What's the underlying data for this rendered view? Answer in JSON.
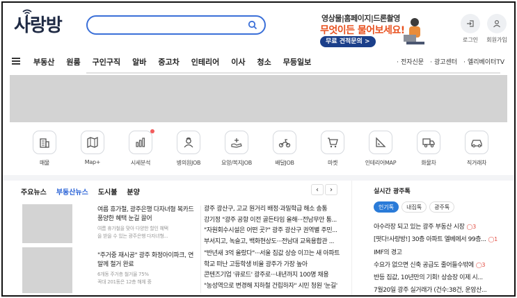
{
  "header": {
    "logo": "사랑방",
    "search": {
      "value": "",
      "placeholder": ""
    },
    "ad": {
      "line1": "영상물|홈페이지|드론촬영",
      "line2": "무엇이든 물어보세요!",
      "button": "무료 견적문의 >"
    },
    "login_label": "로그인",
    "signup_label": "회원가입"
  },
  "nav": {
    "items": [
      "부동산",
      "원룸",
      "구인구직",
      "알바",
      "중고차",
      "인테리어",
      "이사",
      "청소",
      "무등일보"
    ],
    "right": [
      "전자신문",
      "광고센터",
      "엘리베이터TV"
    ]
  },
  "quick_menu": [
    {
      "label": "매물",
      "icon": "building-icon"
    },
    {
      "label": "Map+",
      "icon": "map-icon"
    },
    {
      "label": "시세분석",
      "icon": "chart-icon",
      "badge": true
    },
    {
      "label": "병의원JOB",
      "icon": "nurse-icon"
    },
    {
      "label": "요양/복지JOB",
      "icon": "care-icon"
    },
    {
      "label": "배달JOB",
      "icon": "scooter-icon"
    },
    {
      "label": "마켓",
      "icon": "cart-icon"
    },
    {
      "label": "인테리어MAP",
      "icon": "ruler-icon"
    },
    {
      "label": "화물차",
      "icon": "truck-icon"
    },
    {
      "label": "직거래차",
      "icon": "car-icon"
    }
  ],
  "news": {
    "tabs": [
      "주요뉴스",
      "부동산뉴스",
      "도시불",
      "분양"
    ],
    "active_tab": 1,
    "featured": [
      {
        "title": "여름 휴가철, 광주은행 다자녀형 복카드 풍양한 혜택 눈길 끌어",
        "desc1": "여름 휴가철을 맞아 다양한 할인 혜택",
        "desc2": "을 받을 수 있는 광주은행 다자녀형..."
      },
      {
        "title": "\"주거중 재시공\" 광주 화정아이파크, 연말께 철거 완료",
        "desc1": "6개동 주거층 철거율 75%",
        "desc2": "꼭대 201동은 12층 해체 중"
      }
    ],
    "headlines_top": [
      "광주 광산구, 고교 원거리 배정·과밀학급 해소 송통",
      "강기정 \"광주 공항 이전 골든타임 올해···전남무안 통...",
      "\"자원회수시설은 어떤 곳?\" 광주 광산구 권역별 주민...",
      "부서지고, 녹슬고, 백화현상도···전남대 교육용합관 ..."
    ],
    "headlines_bottom": [
      "\"반년새 3억 올랐다\"···서울 집값 상승 이끄는 새 아파트",
      "학교 떠난 고등학생 비율 광주가 가장 높아",
      "콘텐즈기업 '큐로드' 광주로···내년까지 100명 채용",
      "\"농성역으로 변경해 지하철 건립하자\" 시민 청원 '눈길'"
    ]
  },
  "realtime": {
    "title": "실시간 광주톡",
    "tabs": [
      "인기톡",
      "내집톡",
      "광주톡"
    ],
    "active_tab": 0,
    "items": [
      {
        "text": "아수라장 되고 있는 광주 부동산 시장",
        "count": "3"
      },
      {
        "text": "[떳다!사랑방!] 30층 아파트 엘베에서 99층...",
        "count": "1"
      },
      {
        "text": "IMF의 경고",
        "count": ""
      },
      {
        "text": "수요가 없으면 신축 공급도 줄어들수밖에",
        "count": "3"
      },
      {
        "text": "반등 집값, 10년만의 기회! 상승장 이제 시...",
        "count": ""
      },
      {
        "text": "7월20일 광주 실거래가 (건수:38건, 운암산...",
        "count": ""
      }
    ]
  },
  "colors": {
    "accent": "#2962d6",
    "brand": "#1f2a44",
    "badge": "#f25c5c"
  }
}
